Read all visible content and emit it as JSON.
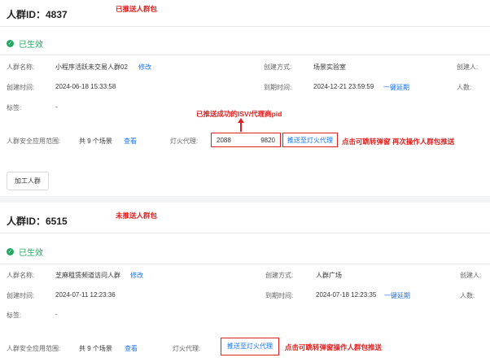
{
  "card1": {
    "title": "人群ID：4837",
    "annotation": "已推送人群包",
    "status": "已生效",
    "name_label": "人群名称:",
    "name_value": "小程序活跃未交易人群02",
    "edit_link": "修改",
    "method_label": "创建方式:",
    "method_value": "场景实验室",
    "creator_label": "创建人:",
    "created_label": "创建时间:",
    "created_value": "2024-06-18 15:33:58",
    "expire_label": "到期时间:",
    "expire_value": "2024-12-21 23:59:59",
    "extend_link": "一键延期",
    "count_label": "人数:",
    "tags_label": "标签:",
    "tags_value": "-",
    "pid_annotation": "已推送成功的ISV/代理商pid",
    "scope_label": "人群安全应用范围:",
    "scope_value": "共 9 个场景",
    "view_link": "查看",
    "agent_label": "灯火代理:",
    "agent_id_left": "2088",
    "agent_id_right": "9820",
    "push_button": "推送至灯火代理",
    "push_annotation": "点击可跳转弹窗  再次操作人群包推送",
    "process_button": "加工人群"
  },
  "card2": {
    "title": "人群ID：6515",
    "annotation": "未推送人群包",
    "status": "已生效",
    "name_label": "人群名称:",
    "name_value": "芝麻租赁频道访问人群",
    "edit_link": "修改",
    "method_label": "创建方式:",
    "method_value": "人群广场",
    "creator_label": "创建人:",
    "created_label": "创建时间:",
    "created_value": "2024-07-11 12:23:36",
    "expire_label": "到期时间:",
    "expire_value": "2024-07-18 12:23:35",
    "extend_link": "一键延期",
    "count_label": "人数:",
    "tags_label": "标签:",
    "tags_value": "-",
    "scope_label": "人群安全应用范围:",
    "scope_value": "共 9 个场景",
    "view_link": "查看",
    "agent_label": "灯火代理:",
    "push_button": "推送至灯火代理",
    "push_annotation": "点击可跳转弹窗操作人群包推送"
  },
  "colors": {
    "accent_link": "#1f73e8",
    "status_green": "#20a860",
    "annotation_red": "#e02020"
  }
}
